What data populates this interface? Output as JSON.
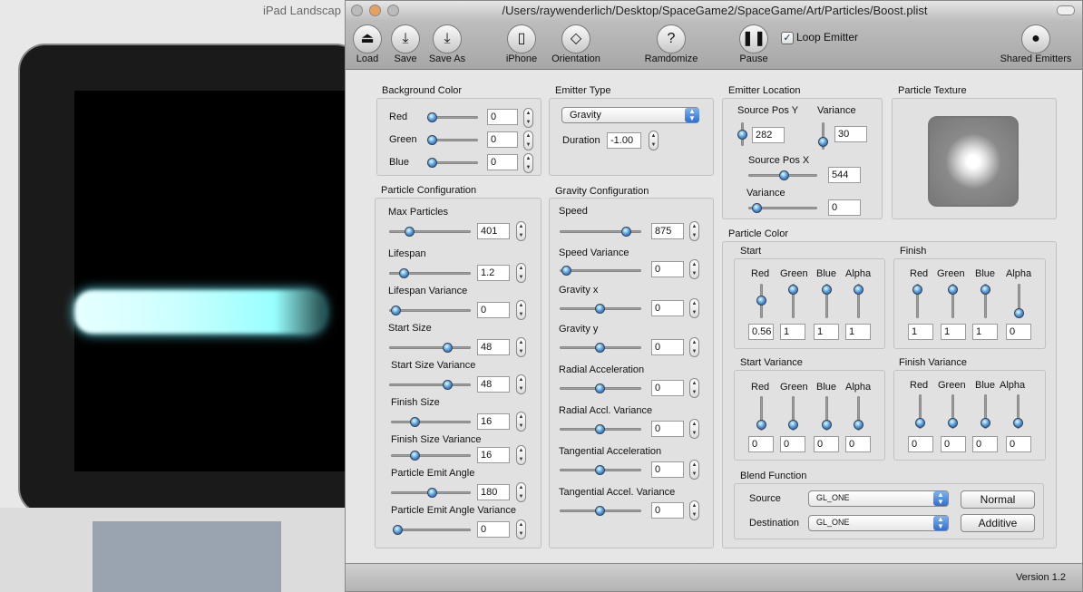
{
  "simulator": {
    "title": "iPad Landscap"
  },
  "window": {
    "title": "/Users/raywenderlich/Desktop/SpaceGame2/SpaceGame/Art/Particles/Boost.plist",
    "version": "Version 1.2"
  },
  "toolbar": {
    "load": "Load",
    "save": "Save",
    "save_as": "Save As",
    "iphone": "iPhone",
    "orientation": "Orientation",
    "randomize": "Ramdomize",
    "pause": "Pause",
    "loop_emitter": "Loop Emitter",
    "loop_checked": true,
    "shared": "Shared Emitters"
  },
  "background_color": {
    "title": "Background Color",
    "red_label": "Red",
    "red": "0",
    "green_label": "Green",
    "green": "0",
    "blue_label": "Blue",
    "blue": "0"
  },
  "emitter_type": {
    "title": "Emitter Type",
    "type": "Gravity",
    "duration_label": "Duration",
    "duration": "-1.00"
  },
  "emitter_location": {
    "title": "Emitter Location",
    "pos_y_label": "Source Pos Y",
    "pos_y": "282",
    "var_y_label": "Variance",
    "var_y": "30",
    "pos_x_label": "Source Pos X",
    "pos_x": "544",
    "var_x_label": "Variance",
    "var_x": "0"
  },
  "particle_texture": {
    "title": "Particle Texture"
  },
  "particle_config": {
    "title": "Particle Configuration",
    "max_label": "Max Particles",
    "max": "401",
    "lifespan_label": "Lifespan",
    "lifespan": "1.2",
    "lifespan_var_label": "Lifespan Variance",
    "lifespan_var": "0",
    "start_size_label": "Start Size",
    "start_size": "48",
    "start_size_var_label": "Start Size Variance",
    "start_size_var": "48",
    "finish_size_label": "Finish Size",
    "finish_size": "16",
    "finish_size_var_label": "Finish Size Variance",
    "finish_size_var": "16",
    "angle_label": "Particle Emit Angle",
    "angle": "180",
    "angle_var_label": "Particle Emit Angle Variance",
    "angle_var": "0"
  },
  "gravity_config": {
    "title": "Gravity Configuration",
    "speed_label": "Speed",
    "speed": "875",
    "speed_var_label": "Speed Variance",
    "speed_var": "0",
    "gx_label": "Gravity x",
    "gx": "0",
    "gy_label": "Gravity y",
    "gy": "0",
    "radial_label": "Radial Acceleration",
    "radial": "0",
    "radial_var_label": "Radial Accl. Variance",
    "radial_var": "0",
    "tang_label": "Tangential Acceleration",
    "tang": "0",
    "tang_var_label": "Tangential Accel. Variance",
    "tang_var": "0"
  },
  "particle_color": {
    "title": "Particle Color",
    "start_title": "Start",
    "finish_title": "Finish",
    "start_var_title": "Start Variance",
    "finish_var_title": "Finish Variance",
    "ch_red": "Red",
    "ch_green": "Green",
    "ch_blue": "Blue",
    "ch_alpha": "Alpha",
    "start": [
      "0.56",
      "1",
      "1",
      "1"
    ],
    "finish": [
      "1",
      "1",
      "1",
      "0"
    ],
    "start_var": [
      "0",
      "0",
      "0",
      "0"
    ],
    "finish_var": [
      "0",
      "0",
      "0",
      "0"
    ]
  },
  "blend": {
    "title": "Blend Function",
    "source_label": "Source",
    "source": "GL_ONE",
    "dest_label": "Destination",
    "dest": "GL_ONE",
    "normal": "Normal",
    "additive": "Additive"
  }
}
